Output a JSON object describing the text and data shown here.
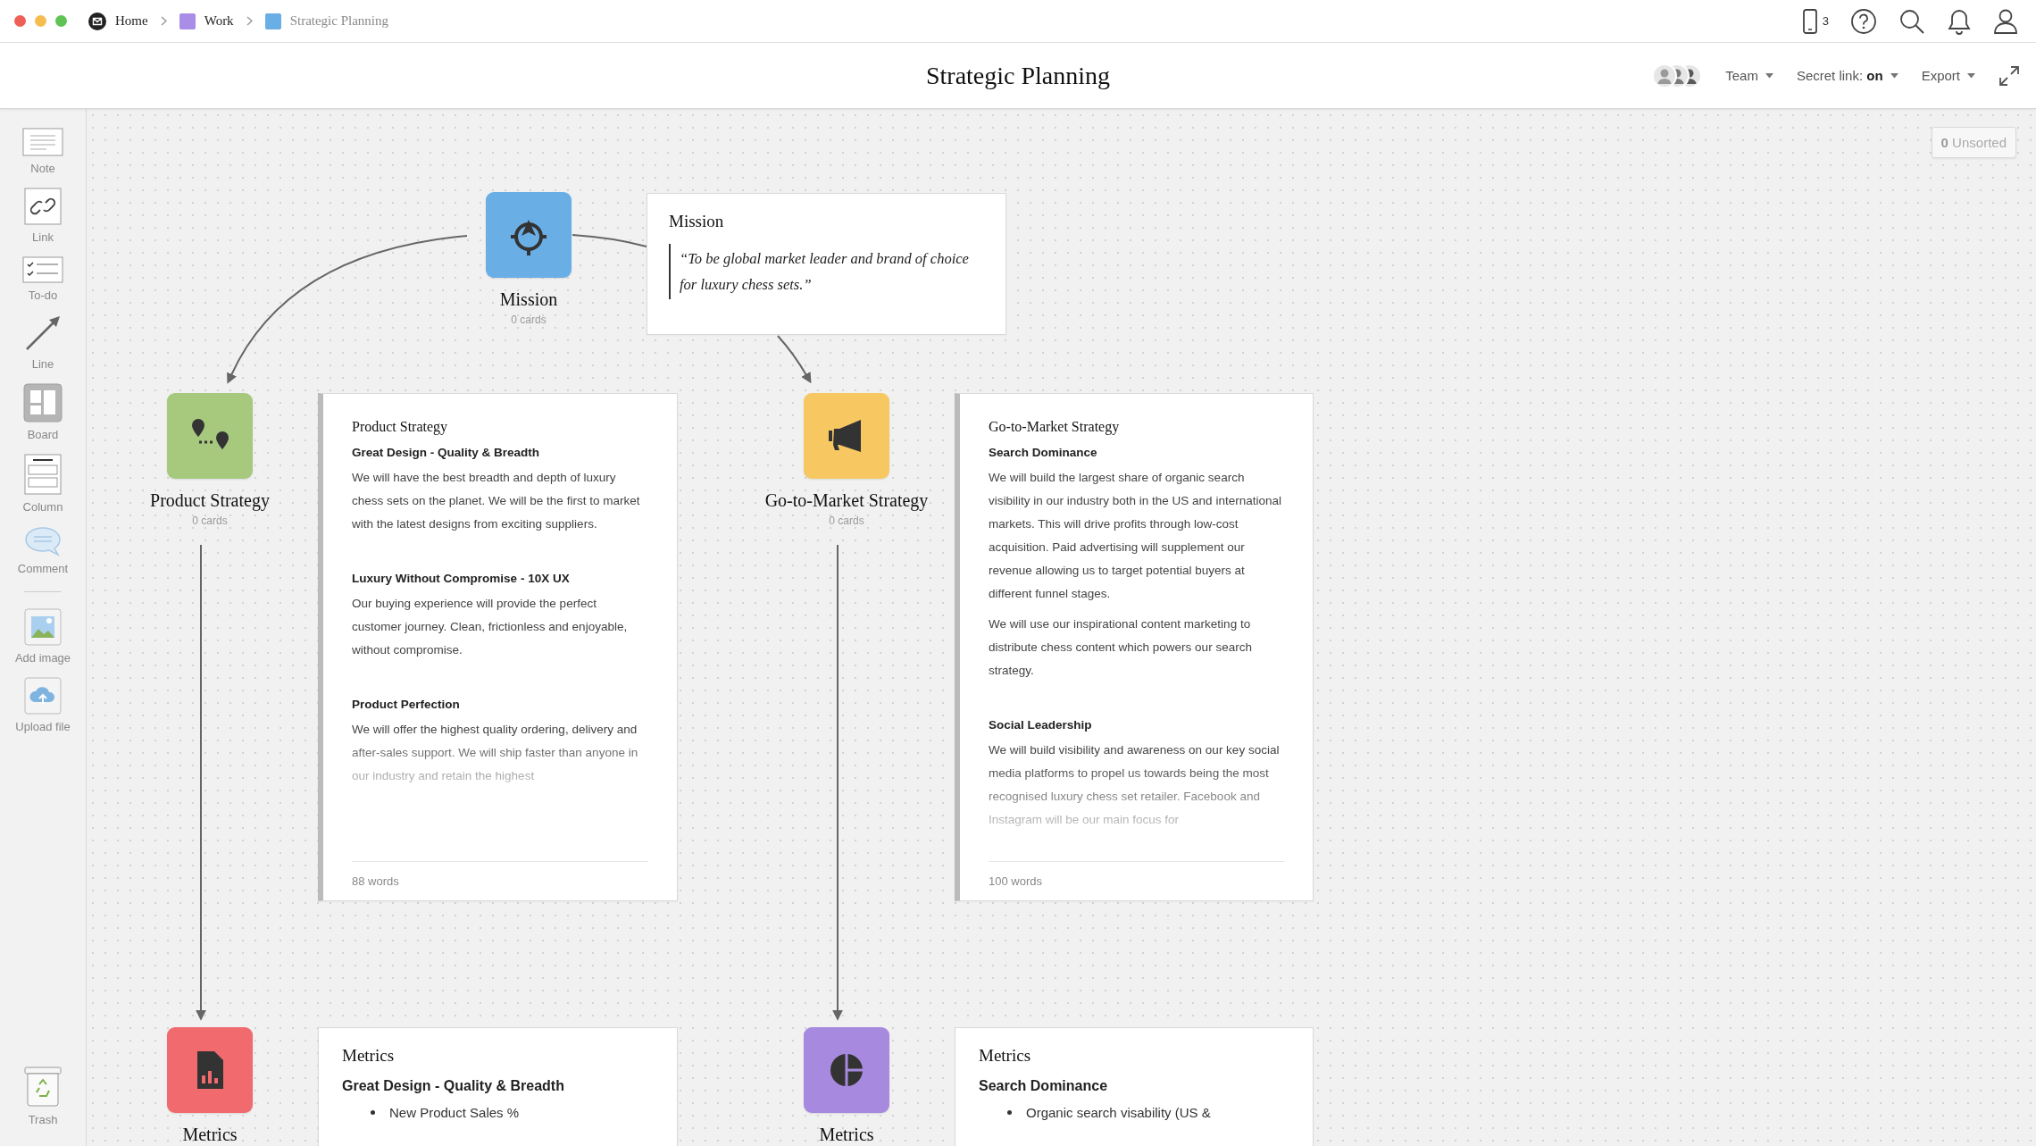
{
  "breadcrumbs": [
    {
      "label": "Home",
      "selected": false
    },
    {
      "label": "Work",
      "color": "#a98de6",
      "selected": false
    },
    {
      "label": "Strategic Planning",
      "color": "#6aaee6",
      "selected": true
    }
  ],
  "device_count": "3",
  "title": "Strategic Planning",
  "header_menus": [
    "Team",
    "Secret link: **on**",
    "Export"
  ],
  "tools": [
    "Note",
    "Link",
    "To-do",
    "Line",
    "Board",
    "Column",
    "Comment",
    "Add image",
    "Upload file"
  ],
  "trash": "Trash",
  "unsorted": "**0** Unsorted",
  "boards": [
    {
      "title": "Mission",
      "count": "0 cards",
      "color": "#6aaee6"
    },
    {
      "title": "Product Strategy",
      "count": "0 cards",
      "color": "#a6c97e"
    },
    {
      "title": "Go-to-Market Strategy",
      "count": "0 cards",
      "color": "#f7c862"
    },
    {
      "title": "Metrics",
      "color": "#f06a6e"
    },
    {
      "title": "Metrics",
      "color": "#a78ae0"
    }
  ],
  "cards": [
    {
      "kind": "quote",
      "title": "Mission",
      "quote": "“To be global market leader and brand of choice for luxury chess sets.”"
    },
    {
      "kind": "note",
      "title": "Product Strategy",
      "sections": [
        {
          "heading": "Great Design - Quality & Breadth",
          "paragraphs": [
            "We will have the best breadth and depth of luxury chess sets on the planet. We will be the first to market with the latest designs from exciting suppliers."
          ]
        },
        {
          "heading": "Luxury Without Compromise - 10X UX",
          "paragraphs": [
            "Our buying experience will provide the perfect customer journey. Clean, frictionless and enjoyable, without compromise."
          ]
        },
        {
          "heading": "Product Perfection",
          "paragraphs": [
            "We will offer the highest quality ordering, delivery and after-sales support. We will ship faster than anyone in our industry and retain the highest"
          ]
        }
      ],
      "footer": "88 words"
    },
    {
      "kind": "note",
      "title": "Go-to-Market Strategy",
      "sections": [
        {
          "heading": "Search Dominance",
          "paragraphs": [
            "We will build the largest share of organic search visibility in our industry both in the US and international markets. This will drive profits through low-cost acquisition. Paid advertising will supplement our revenue allowing us to target potential buyers at different funnel stages.",
            "We will use our inspirational content marketing to distribute chess content which powers our search strategy."
          ]
        },
        {
          "heading": "Social Leadership",
          "paragraphs": [
            "We will build visibility and awareness on our key social media platforms to propel us towards being the most recognised luxury chess set retailer. Facebook and Instagram will be our main focus for"
          ]
        }
      ],
      "footer": "100 words"
    },
    {
      "kind": "metrics",
      "title": "Metrics",
      "heading": "Great Design - Quality & Breadth",
      "bullets": [
        "New Product Sales %"
      ]
    },
    {
      "kind": "metrics",
      "title": "Metrics",
      "heading": "Search Dominance",
      "bullets": [
        "Organic search visability (US &"
      ]
    }
  ]
}
